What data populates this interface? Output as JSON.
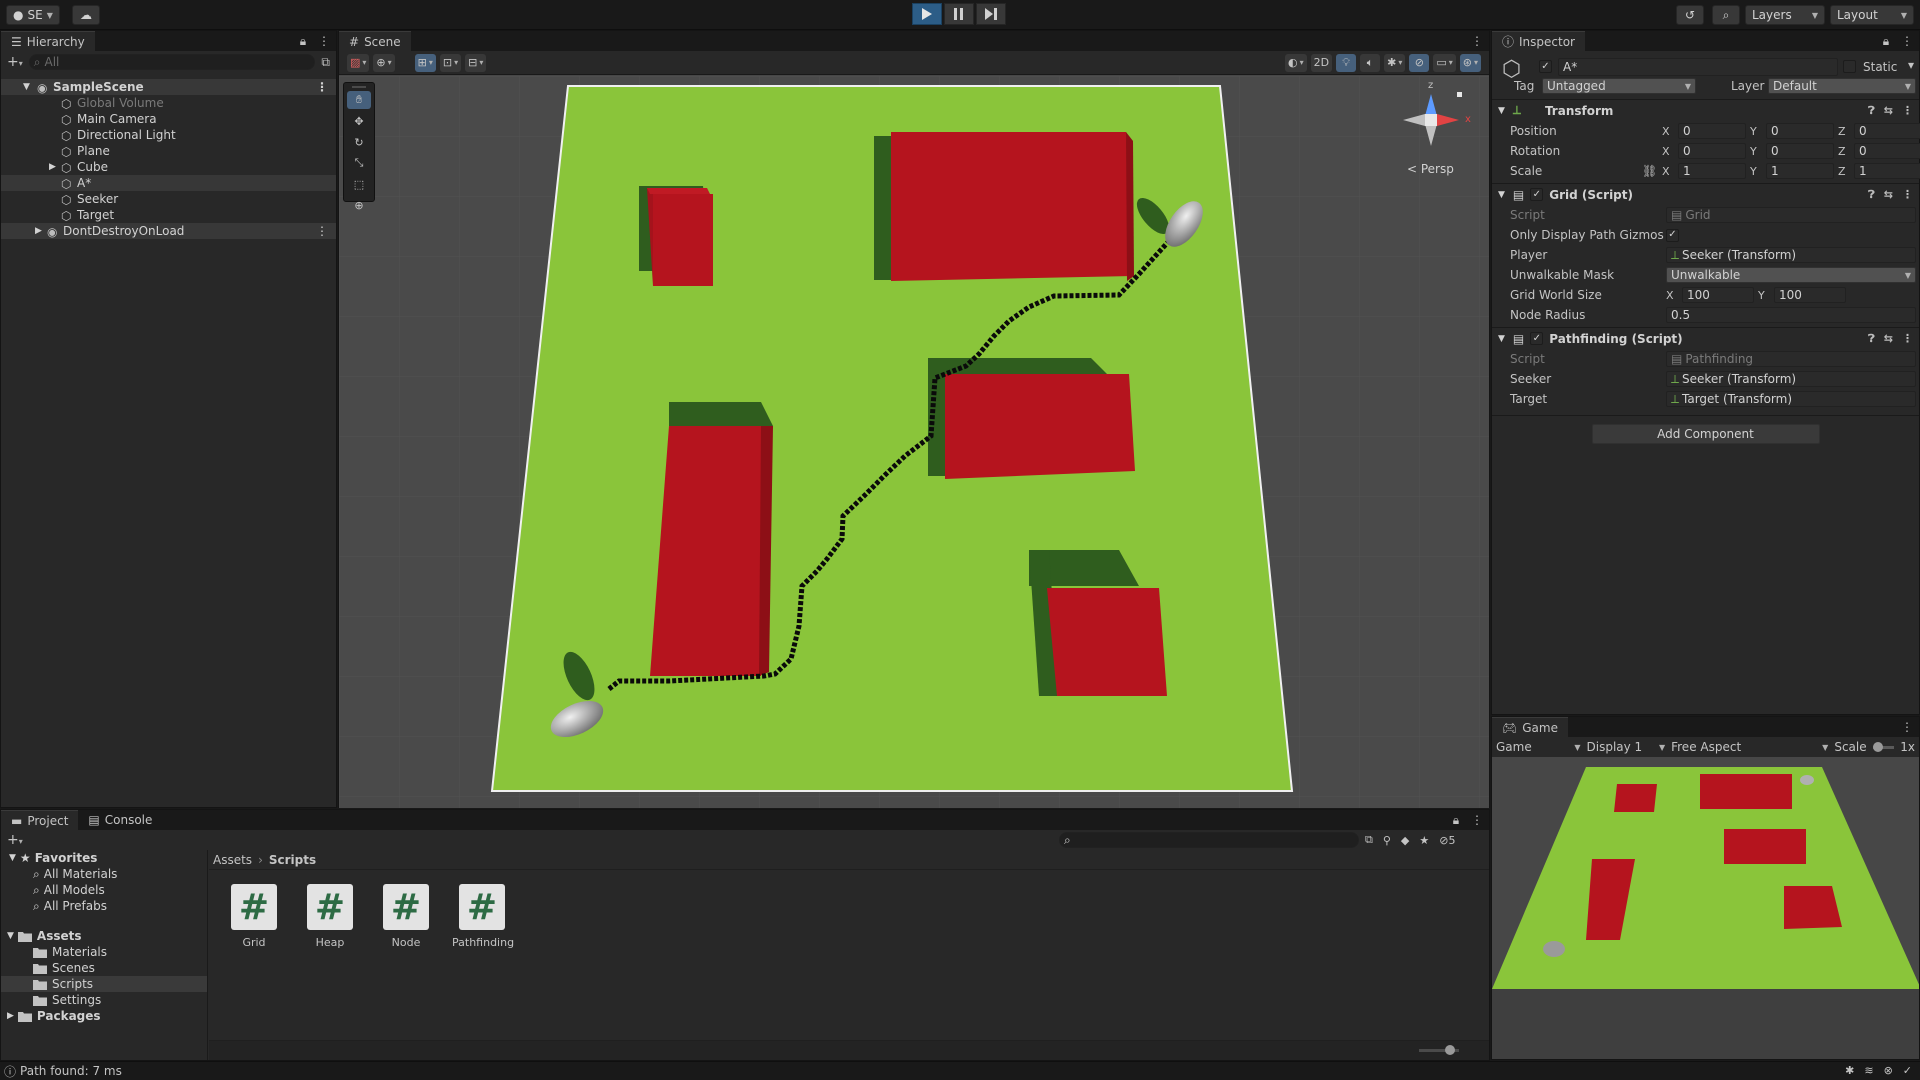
{
  "colors": {
    "accent": "#2c5d87",
    "ground": "#8ac53a",
    "obstacle": "#b5141e",
    "path": "#0a0a0a",
    "background": "#191919",
    "panel": "#282828"
  },
  "toolbar": {
    "account": "SE",
    "layers": "Layers",
    "layout": "Layout"
  },
  "hierarchy": {
    "tab": "Hierarchy",
    "search_placeholder": "All",
    "scene": "SampleScene",
    "items": [
      {
        "label": "Global Volume"
      },
      {
        "label": "Main Camera"
      },
      {
        "label": "Directional Light"
      },
      {
        "label": "Plane"
      },
      {
        "label": "Cube"
      },
      {
        "label": "A*"
      },
      {
        "label": "Seeker"
      },
      {
        "label": "Target"
      }
    ],
    "dont_destroy": "DontDestroyOnLoad"
  },
  "scene": {
    "tab": "Scene",
    "mode_2d": "2D",
    "persp_label": "< Persp",
    "gizmo_y": "y",
    "gizmo_x": "x",
    "gizmo_z": "z"
  },
  "inspector": {
    "tab": "Inspector",
    "object_name": "A*",
    "static_label": "Static",
    "tag_label": "Tag",
    "tag_value": "Untagged",
    "layer_label": "Layer",
    "layer_value": "Default",
    "transform": {
      "title": "Transform",
      "position_label": "Position",
      "rotation_label": "Rotation",
      "scale_label": "Scale",
      "position": {
        "x": "0",
        "y": "0",
        "z": "0"
      },
      "rotation": {
        "x": "0",
        "y": "0",
        "z": "0"
      },
      "scale": {
        "x": "1",
        "y": "1",
        "z": "1"
      }
    },
    "grid": {
      "title": "Grid (Script)",
      "script_label": "Script",
      "script_value": "Grid",
      "only_display_label": "Only Display Path Gizmos",
      "player_label": "Player",
      "player_value": "Seeker (Transform)",
      "unwalkable_label": "Unwalkable Mask",
      "unwalkable_value": "Unwalkable",
      "world_size_label": "Grid World Size",
      "world_size_x": "100",
      "world_size_y": "100",
      "node_radius_label": "Node Radius",
      "node_radius_value": "0.5"
    },
    "pathfinding": {
      "title": "Pathfinding (Script)",
      "script_label": "Script",
      "script_value": "Pathfinding",
      "seeker_label": "Seeker",
      "seeker_value": "Seeker (Transform)",
      "target_label": "Target",
      "target_value": "Target (Transform)"
    },
    "add_component": "Add Component"
  },
  "game": {
    "tab": "Game",
    "mode": "Game",
    "display": "Display 1",
    "aspect": "Free Aspect",
    "scale_label": "Scale",
    "scale_value": "1x"
  },
  "project": {
    "tab_project": "Project",
    "tab_console": "Console",
    "favorites_label": "Favorites",
    "favorites": [
      {
        "label": "All Materials"
      },
      {
        "label": "All Models"
      },
      {
        "label": "All Prefabs"
      }
    ],
    "assets_label": "Assets",
    "asset_folders": [
      {
        "label": "Materials"
      },
      {
        "label": "Scenes"
      },
      {
        "label": "Scripts"
      },
      {
        "label": "Settings"
      }
    ],
    "packages_label": "Packages",
    "breadcrumb_root": "Assets",
    "breadcrumb_current": "Scripts",
    "hidden_count": "5",
    "scripts": [
      {
        "name": "Grid"
      },
      {
        "name": "Heap"
      },
      {
        "name": "Node"
      },
      {
        "name": "Pathfinding"
      }
    ]
  },
  "status": {
    "message": "Path found: 7 ms"
  }
}
